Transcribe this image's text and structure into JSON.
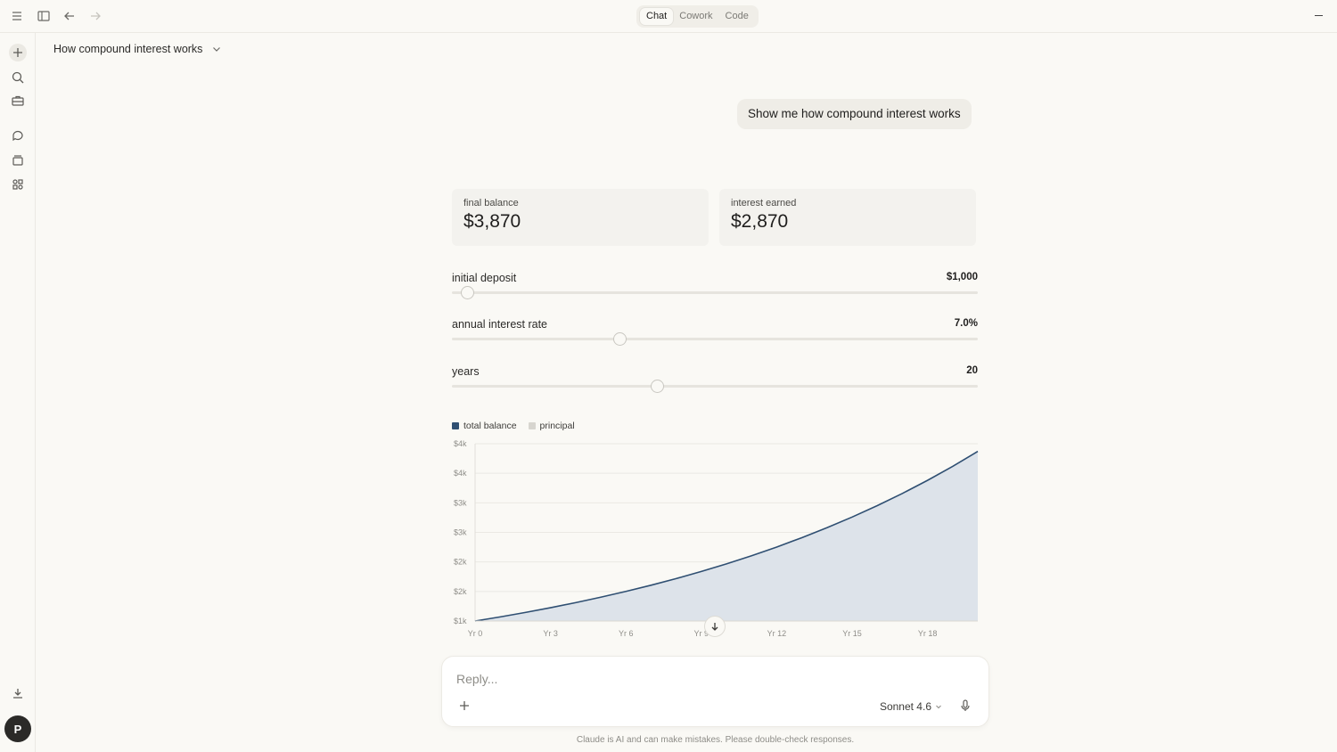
{
  "header": {
    "modes": [
      "Chat",
      "Cowork",
      "Code"
    ],
    "active_mode": "Chat"
  },
  "conversation": {
    "title": "How compound interest works"
  },
  "user_message": "Show me how compound interest works",
  "stats": {
    "final_balance": {
      "label": "final balance",
      "value": "$3,870"
    },
    "interest_earned": {
      "label": "interest earned",
      "value": "$2,870"
    }
  },
  "sliders": [
    {
      "label": "initial deposit",
      "value": "$1,000",
      "position": 0.03
    },
    {
      "label": "annual interest rate",
      "value": "7.0%",
      "position": 0.32
    },
    {
      "label": "years",
      "value": "20",
      "position": 0.39
    }
  ],
  "avatar_initial": "P",
  "reply": {
    "placeholder": "Reply...",
    "model": "Sonnet 4.6"
  },
  "disclaimer": "Claude is AI and can make mistakes. Please double-check responses.",
  "colors": {
    "total_balance": "#2f4f72",
    "total_fill": "#dde3ea",
    "principal": "#d7d5cf"
  },
  "chart_data": {
    "type": "area",
    "legend": [
      "total balance",
      "principal"
    ],
    "y_tick_labels": [
      "$4k",
      "$4k",
      "$3k",
      "$3k",
      "$2k",
      "$2k",
      "$1k"
    ],
    "x_tick_labels": [
      "Yr 0",
      "Yr 3",
      "Yr 6",
      "Yr 9",
      "Yr 12",
      "Yr 15",
      "Yr 18"
    ],
    "ylim": [
      1000,
      4000
    ],
    "xlim": [
      0,
      20
    ],
    "series": [
      {
        "name": "total balance",
        "x": [
          0,
          1,
          2,
          3,
          4,
          5,
          6,
          7,
          8,
          9,
          10,
          11,
          12,
          13,
          14,
          15,
          16,
          17,
          18,
          19,
          20
        ],
        "values": [
          1000,
          1070,
          1145,
          1225,
          1311,
          1403,
          1501,
          1606,
          1718,
          1838,
          1967,
          2105,
          2252,
          2410,
          2579,
          2759,
          2952,
          3159,
          3380,
          3617,
          3870
        ]
      },
      {
        "name": "principal",
        "x": [
          0,
          20
        ],
        "values": [
          1000,
          1000
        ]
      }
    ]
  }
}
